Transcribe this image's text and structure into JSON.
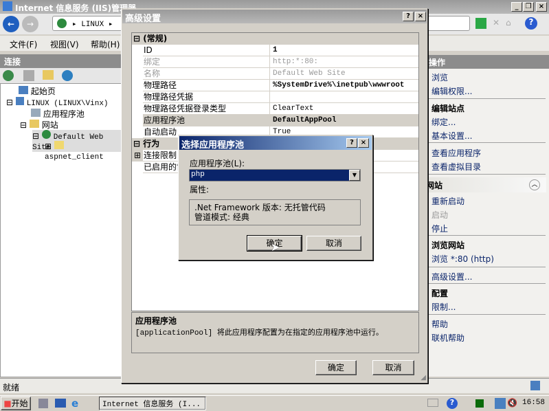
{
  "window": {
    "title": "Internet 信息服务 (IIS)管理器",
    "address": "LINUX"
  },
  "menu": [
    "文件(F)",
    "视图(V)",
    "帮助(H)"
  ],
  "connections": {
    "header": "连接",
    "tree": [
      "起始页",
      "LINUX (LINUX\\Vinx)",
      "应用程序池",
      "网站",
      "Default Web Site",
      "aspnet_client"
    ]
  },
  "actions": {
    "header": "操作",
    "items": [
      {
        "type": "link",
        "label": "浏览"
      },
      {
        "type": "link",
        "label": "编辑权限..."
      },
      {
        "type": "head",
        "label": "编辑站点"
      },
      {
        "type": "link",
        "label": "绑定..."
      },
      {
        "type": "link",
        "label": "基本设置..."
      },
      {
        "type": "link",
        "label": "查看应用程序"
      },
      {
        "type": "link",
        "label": "查看虚拟目录"
      },
      {
        "type": "section",
        "label": "管理网站"
      },
      {
        "type": "link",
        "label": "重新启动"
      },
      {
        "type": "disabled",
        "label": "启动"
      },
      {
        "type": "link",
        "label": "停止"
      },
      {
        "type": "head",
        "label": "浏览网站"
      },
      {
        "type": "link",
        "label": "浏览 *:80 (http)"
      },
      {
        "type": "link",
        "label": "高级设置..."
      },
      {
        "type": "head",
        "label": "配置"
      },
      {
        "type": "link",
        "label": "限制..."
      },
      {
        "type": "link",
        "label": "帮助"
      },
      {
        "type": "link",
        "label": "联机帮助"
      }
    ]
  },
  "status": "就绪",
  "advanced": {
    "title": "高级设置",
    "cat_general": "(常规)",
    "cat_behavior": "行为",
    "rows": [
      {
        "k": "ID",
        "v": "1",
        "bold": true
      },
      {
        "k": "绑定",
        "v": "http:*:80:",
        "grey": true
      },
      {
        "k": "名称",
        "v": "Default Web Site",
        "grey": true
      },
      {
        "k": "物理路径",
        "v": "%SystemDrive%\\inetpub\\wwwroot",
        "bold": true
      },
      {
        "k": "物理路径凭据",
        "v": ""
      },
      {
        "k": "物理路径凭据登录类型",
        "v": "ClearText"
      },
      {
        "k": "应用程序池",
        "v": "DefaultAppPool",
        "bold": true,
        "sel": true
      },
      {
        "k": "自动启动",
        "v": "True"
      }
    ],
    "rows2": [
      "连接限制",
      "已启用的协议"
    ],
    "desc_title": "应用程序池",
    "desc_text": "[applicationPool] 将此应用程序配置为在指定的应用程序池中运行。",
    "ok": "确定",
    "cancel": "取消"
  },
  "select_pool": {
    "title": "选择应用程序池",
    "label": "应用程序池(L):",
    "value": "php",
    "props_label": "属性:",
    "prop1": ".Net Framework 版本: 无托管代码",
    "prop2": "管道模式: 经典",
    "ok": "确定",
    "cancel": "取消"
  },
  "taskbar": {
    "start": "开始",
    "task": "Internet 信息服务 (I...",
    "clock": "16:58"
  }
}
